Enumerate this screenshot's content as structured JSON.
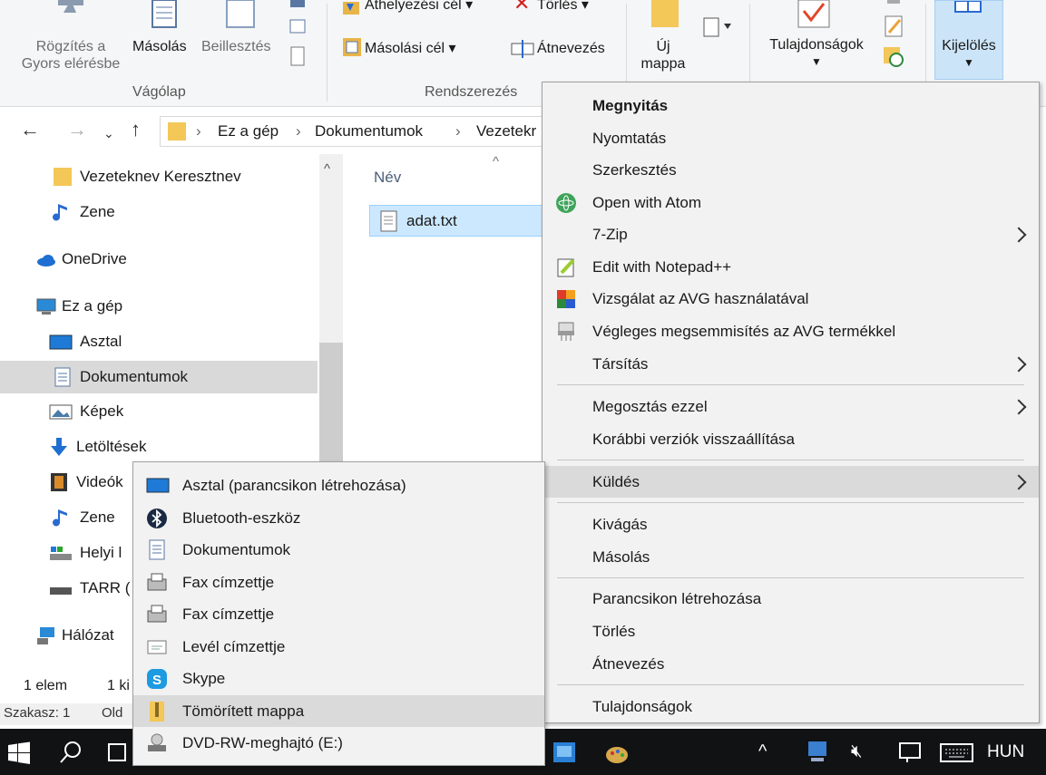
{
  "ribbon": {
    "move_target": "Áthelyezési cél",
    "copy_target": "Másolási cél",
    "delete": "Törlés",
    "rename": "Átnevezés",
    "new_folder_line1": "Új",
    "new_folder_line2": "mappa",
    "properties": "Tulajdonságok",
    "select": "Kijelölés",
    "pin_line1": "Rögzítés a",
    "pin_line2": "Gyors elérésbe",
    "copy": "Másolás",
    "paste": "Beillesztés",
    "group_clipboard": "Vágólap",
    "group_organize": "Rendszerezés"
  },
  "address": {
    "crumbs": [
      "Ez a gép",
      "Dokumentumok",
      "Vezetekr"
    ]
  },
  "navpane": {
    "items": [
      "Vezeteknev Keresztnev",
      "Zene",
      "OneDrive",
      "Ez a gép",
      "Asztal",
      "Dokumentumok",
      "Képek",
      "Letöltések",
      "Videók",
      "Zene",
      "Helyi l",
      "TARR (",
      "Hálózat"
    ]
  },
  "filelist": {
    "column_name": "Név",
    "file": "adat.txt"
  },
  "status": {
    "count": "1 elem",
    "selected": "1 ki",
    "section": "Szakasz: 1",
    "page": "Old"
  },
  "taskbar": {
    "language": "HUN"
  },
  "context_menu": {
    "items": [
      "Megnyitás",
      "Nyomtatás",
      "Szerkesztés",
      "Open with Atom",
      "7-Zip",
      "Edit with Notepad++",
      "Vizsgálat az AVG használatával",
      "Végleges megsemmisítés az AVG termékkel",
      "Társítás",
      "Megosztás ezzel",
      "Korábbi verziók visszaállítása",
      "Küldés",
      "Kivágás",
      "Másolás",
      "Parancsikon létrehozása",
      "Törlés",
      "Átnevezés",
      "Tulajdonságok"
    ]
  },
  "send_to_menu": {
    "items": [
      "Asztal (parancsikon létrehozása)",
      "Bluetooth-eszköz",
      "Dokumentumok",
      "Fax címzettje",
      "Fax címzettje",
      "Levél címzettje",
      "Skype",
      "Tömörített mappa",
      "DVD-RW-meghajtó (E:)"
    ]
  },
  "colors": {
    "selection": "#cce8ff",
    "menu_bg": "#f2f2f2",
    "menu_highlight": "#dadada",
    "taskbar": "#101214"
  }
}
